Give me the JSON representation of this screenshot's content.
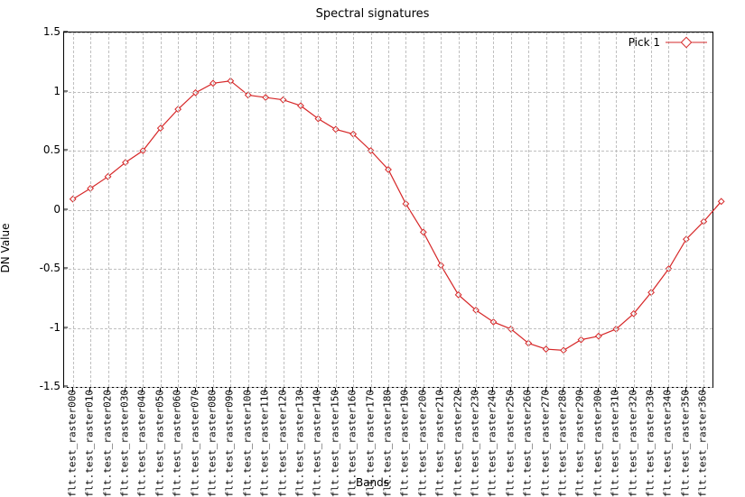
{
  "title": "Spectral signatures",
  "xlabel": "Bands",
  "ylabel": "DN Value",
  "legend": {
    "series0": "Pick 1"
  },
  "yticks": [
    "-1.5",
    "-1",
    "-0.5",
    "0",
    "0.5",
    "1",
    "1.5"
  ],
  "chart_data": {
    "type": "line",
    "title": "Spectral signatures",
    "xlabel": "Bands",
    "ylabel": "DN Value",
    "ylim": [
      -1.5,
      1.5
    ],
    "categories": [
      "flt.test_raster000",
      "flt.test_raster010",
      "flt.test_raster020",
      "flt.test_raster030",
      "flt.test_raster040",
      "flt.test_raster050",
      "flt.test_raster060",
      "flt.test_raster070",
      "flt.test_raster080",
      "flt.test_raster090",
      "flt.test_raster100",
      "flt.test_raster110",
      "flt.test_raster120",
      "flt.test_raster130",
      "flt.test_raster140",
      "flt.test_raster150",
      "flt.test_raster160",
      "flt.test_raster170",
      "flt.test_raster180",
      "flt.test_raster190",
      "flt.test_raster200",
      "flt.test_raster210",
      "flt.test_raster220",
      "flt.test_raster230",
      "flt.test_raster240",
      "flt.test_raster250",
      "flt.test_raster260",
      "flt.test_raster270",
      "flt.test_raster280",
      "flt.test_raster290",
      "flt.test_raster300",
      "flt.test_raster310",
      "flt.test_raster320",
      "flt.test_raster330",
      "flt.test_raster340",
      "flt.test_raster350",
      "flt.test_raster360"
    ],
    "series": [
      {
        "name": "Pick 1",
        "values": [
          0.09,
          0.18,
          0.28,
          0.4,
          0.5,
          0.69,
          0.85,
          0.99,
          1.07,
          1.09,
          0.97,
          0.95,
          0.93,
          0.88,
          0.77,
          0.68,
          0.64,
          0.5,
          0.34,
          0.05,
          -0.19,
          -0.47,
          -0.72,
          -0.85,
          -0.95,
          -1.01,
          -1.13,
          -1.18,
          -1.19,
          -1.1,
          -1.07,
          -1.01,
          -0.88,
          -0.7,
          -0.5,
          -0.25,
          -0.1,
          0.07
        ]
      }
    ],
    "legend_position": "top-right",
    "grid": true
  }
}
